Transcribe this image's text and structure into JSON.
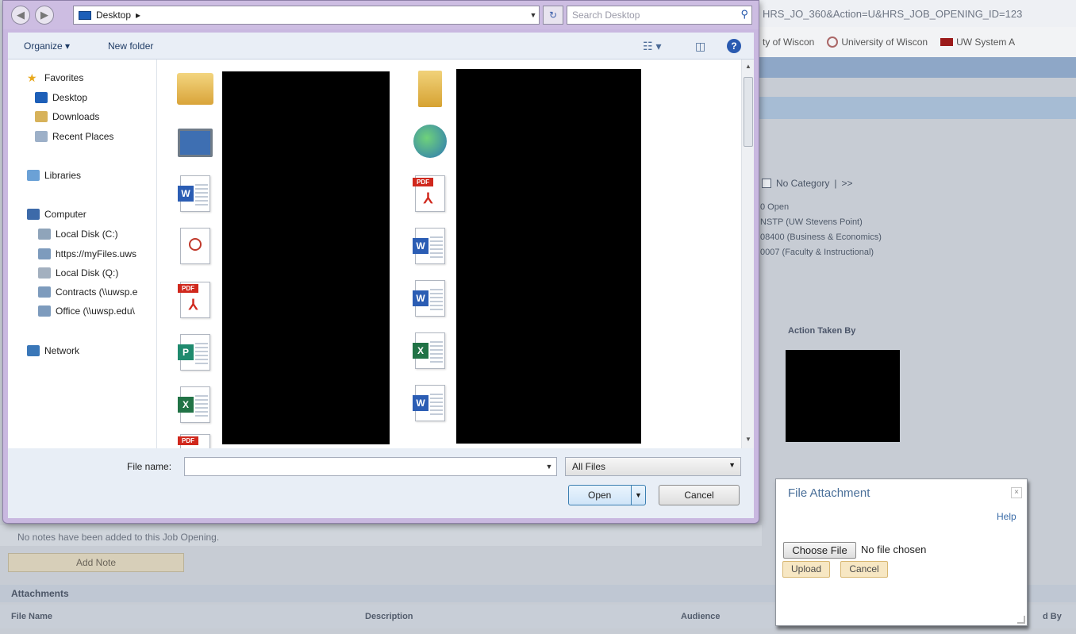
{
  "background": {
    "url_text": "HRS_JO_360&Action=U&HRS_JOB_OPENING_ID=123",
    "favorites": [
      "ty of Wiscon",
      "University of Wiscon",
      "UW System A"
    ],
    "category_label": "No Category",
    "category_separator": "|",
    "category_more": ">>",
    "info_lines": [
      "0 Open",
      "NSTP (UW Stevens Point)",
      "08400 (Business & Economics)",
      "0007 (Faculty & Instructional)"
    ],
    "action_taken_by": "Action Taken By",
    "notes_text": "No notes have been added to this Job Opening.",
    "add_note_label": "Add Note",
    "attachments_heading": "Attachments",
    "columns": [
      "File Name",
      "Description",
      "Audience",
      "d By"
    ]
  },
  "dialog": {
    "address_path": "Desktop",
    "address_arrow": "▸",
    "search_placeholder": "Search Desktop",
    "toolbar": {
      "organize": "Organize ▾",
      "new_folder": "New folder"
    },
    "nav": {
      "favorites": "Favorites",
      "desktop": "Desktop",
      "downloads": "Downloads",
      "recent_places": "Recent Places",
      "libraries": "Libraries",
      "computer": "Computer",
      "local_c": "Local Disk (C:)",
      "myfiles": "https://myFiles.uws",
      "local_q": "Local Disk (Q:)",
      "contracts": "Contracts (\\\\uwsp.e",
      "office": "Office (\\\\uwsp.edu\\",
      "network": "Network"
    },
    "file_name_label": "File name:",
    "file_name_value": "",
    "file_type": "All Files",
    "open_label": "Open",
    "cancel_label": "Cancel"
  },
  "attachment_popup": {
    "title": "File Attachment",
    "close": "×",
    "help": "Help",
    "choose_file": "Choose File",
    "no_file": "No file chosen",
    "upload": "Upload",
    "cancel": "Cancel"
  }
}
